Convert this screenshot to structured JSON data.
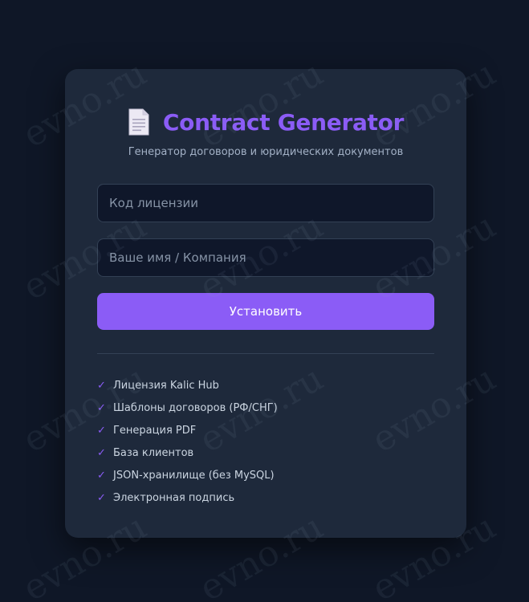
{
  "header": {
    "icon": "document-icon",
    "title": "Contract Generator",
    "subtitle": "Генератор договоров и юридических документов"
  },
  "form": {
    "license_placeholder": "Код лицензии",
    "name_placeholder": "Ваше имя / Компания",
    "install_label": "Установить"
  },
  "features": [
    {
      "check": "✓",
      "label": "Лицензия Kalic Hub"
    },
    {
      "check": "✓",
      "label": "Шаблоны договоров (РФ/СНГ)"
    },
    {
      "check": "✓",
      "label": "Генерация PDF"
    },
    {
      "check": "✓",
      "label": "База клиентов"
    },
    {
      "check": "✓",
      "label": "JSON-хранилище (без MySQL)"
    },
    {
      "check": "✓",
      "label": "Электронная подпись"
    }
  ],
  "watermark": {
    "text": "evno.ru"
  },
  "colors": {
    "accent": "#8b5cf6",
    "background": "#0f1727",
    "card": "#1e293b",
    "input": "#0f172a"
  }
}
